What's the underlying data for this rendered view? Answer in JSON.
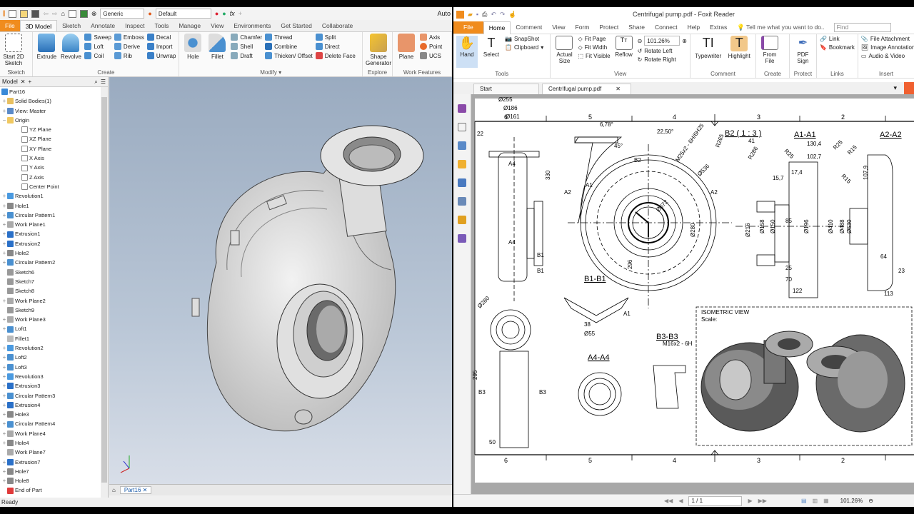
{
  "inventor": {
    "quick_access": {
      "appearance": "Generic",
      "material": "Default",
      "title_fragment": "Auto"
    },
    "tabs": [
      "File",
      "3D Model",
      "Sketch",
      "Annotate",
      "Inspect",
      "Tools",
      "Manage",
      "View",
      "Environments",
      "Get Started",
      "Collaborate"
    ],
    "active_tab": "3D Model",
    "ribbon": {
      "sketch": {
        "label": "Sketch",
        "start_sketch": "Start 2D Sketch"
      },
      "create": {
        "label": "Create",
        "extrude": "Extrude",
        "revolve": "Revolve",
        "sweep": "Sweep",
        "loft": "Loft",
        "coil": "Coil",
        "emboss": "Emboss",
        "derive": "Derive",
        "rib": "Rib",
        "decal": "Decal",
        "import": "Import",
        "unwrap": "Unwrap"
      },
      "modify": {
        "label": "Modify",
        "hole": "Hole",
        "fillet": "Fillet",
        "chamfer": "Chamfer",
        "shell": "Shell",
        "draft": "Draft",
        "thread": "Thread",
        "combine": "Combine",
        "thicken": "Thicken/ Offset",
        "split": "Split",
        "direct": "Direct",
        "delete_face": "Delete Face"
      },
      "explore": {
        "label": "Explore",
        "shape_generator": "Shape Generator"
      },
      "work_features": {
        "label": "Work Features",
        "plane": "Plane",
        "axis": "Axis",
        "point": "Point",
        "ucs": "UCS"
      }
    },
    "browser": {
      "tab": "Model",
      "items": [
        {
          "label": "Part16",
          "level": 0,
          "exp": ""
        },
        {
          "label": "Solid Bodies(1)",
          "level": 1,
          "exp": "+"
        },
        {
          "label": "View: Master",
          "level": 1,
          "exp": "+"
        },
        {
          "label": "Origin",
          "level": 1,
          "exp": "−"
        },
        {
          "label": "YZ Plane",
          "level": 2,
          "exp": ""
        },
        {
          "label": "XZ Plane",
          "level": 2,
          "exp": ""
        },
        {
          "label": "XY Plane",
          "level": 2,
          "exp": ""
        },
        {
          "label": "X Axis",
          "level": 2,
          "exp": ""
        },
        {
          "label": "Y Axis",
          "level": 2,
          "exp": ""
        },
        {
          "label": "Z Axis",
          "level": 2,
          "exp": ""
        },
        {
          "label": "Center Point",
          "level": 2,
          "exp": ""
        },
        {
          "label": "Revolution1",
          "level": 1,
          "exp": "+"
        },
        {
          "label": "Hole1",
          "level": 1,
          "exp": "+"
        },
        {
          "label": "Circular Pattern1",
          "level": 1,
          "exp": "+"
        },
        {
          "label": "Work Plane1",
          "level": 1,
          "exp": "+"
        },
        {
          "label": "Extrusion1",
          "level": 1,
          "exp": "+"
        },
        {
          "label": "Extrusion2",
          "level": 1,
          "exp": "+"
        },
        {
          "label": "Hole2",
          "level": 1,
          "exp": "+"
        },
        {
          "label": "Circular Pattern2",
          "level": 1,
          "exp": "+"
        },
        {
          "label": "Sketch6",
          "level": 1,
          "exp": ""
        },
        {
          "label": "Sketch7",
          "level": 1,
          "exp": ""
        },
        {
          "label": "Sketch8",
          "level": 1,
          "exp": ""
        },
        {
          "label": "Work Plane2",
          "level": 1,
          "exp": "+"
        },
        {
          "label": "Sketch9",
          "level": 1,
          "exp": ""
        },
        {
          "label": "Work Plane3",
          "level": 1,
          "exp": "+"
        },
        {
          "label": "Loft1",
          "level": 1,
          "exp": "+"
        },
        {
          "label": "Fillet1",
          "level": 1,
          "exp": ""
        },
        {
          "label": "Revolution2",
          "level": 1,
          "exp": "+"
        },
        {
          "label": "Loft2",
          "level": 1,
          "exp": "+"
        },
        {
          "label": "Loft3",
          "level": 1,
          "exp": "+"
        },
        {
          "label": "Revolution3",
          "level": 1,
          "exp": "+"
        },
        {
          "label": "Extrusion3",
          "level": 1,
          "exp": "+"
        },
        {
          "label": "Circular Pattern3",
          "level": 1,
          "exp": "+"
        },
        {
          "label": "Extrusion4",
          "level": 1,
          "exp": "+"
        },
        {
          "label": "Hole3",
          "level": 1,
          "exp": "+"
        },
        {
          "label": "Circular Pattern4",
          "level": 1,
          "exp": "+"
        },
        {
          "label": "Work Plane4",
          "level": 1,
          "exp": "+"
        },
        {
          "label": "Hole4",
          "level": 1,
          "exp": "+"
        },
        {
          "label": "Work Plane7",
          "level": 1,
          "exp": ""
        },
        {
          "label": "Extrusion7",
          "level": 1,
          "exp": "+"
        },
        {
          "label": "Hole7",
          "level": 1,
          "exp": "+"
        },
        {
          "label": "Hole8",
          "level": 1,
          "exp": "+"
        },
        {
          "label": "End of Part",
          "level": 1,
          "exp": ""
        }
      ]
    },
    "doc_tab": "Part16",
    "status": "Ready"
  },
  "foxit": {
    "title": "Centrifugal pump.pdf - Foxit Reader",
    "tabs": [
      "File",
      "Home",
      "Comment",
      "View",
      "Form",
      "Protect",
      "Share",
      "Connect",
      "Help",
      "Extras"
    ],
    "active_tab": "Home",
    "tell_me": "Tell me what you want to do..",
    "find_placeholder": "Find",
    "ribbon": {
      "tools": {
        "label": "Tools",
        "hand": "Hand",
        "select": "Select",
        "snapshot": "SnapShot",
        "clipboard": "Clipboard"
      },
      "view": {
        "label": "View",
        "actual_size": "Actual Size",
        "fit_page": "Fit Page",
        "fit_width": "Fit Width",
        "fit_visible": "Fit Visible",
        "reflow": "Reflow",
        "zoom": "101.26%",
        "rotate_left": "Rotate Left",
        "rotate_right": "Rotate Right"
      },
      "comment": {
        "label": "Comment",
        "typewriter": "Typewriter",
        "highlight": "Highlight"
      },
      "create": {
        "label": "Create",
        "from_file": "From File"
      },
      "protect": {
        "label": "Protect",
        "pdf_sign": "PDF Sign"
      },
      "links": {
        "label": "Links",
        "link": "Link",
        "bookmark": "Bookmark"
      },
      "insert": {
        "label": "Insert",
        "file_attachment": "File Attachment",
        "image_annotation": "Image Annotation",
        "audio_video": "Audio & Video"
      }
    },
    "doc_tabs": [
      "Start",
      "Centrifugal pump.pdf"
    ],
    "page_box": "1 / 1",
    "zoom_status": "101.26%",
    "drawing": {
      "ruler": [
        "6",
        "5",
        "4",
        "3",
        "2"
      ],
      "section_titles": {
        "b2": "B2 ( 1 : 3 )",
        "a1": "A1-A1",
        "a2": "A2-A2",
        "b1": "B1-B1",
        "a4": "A4-A4",
        "b3": "B3-B3"
      },
      "labels": [
        "Ø255",
        "Ø186",
        "Ø161",
        "22",
        "6,78°",
        "22,50°",
        "45°",
        "M25x2 - 6H/6H25",
        "Ø536",
        "Ø572",
        "330",
        "296",
        "A1",
        "A2",
        "A2",
        "A4",
        "A4",
        "B1",
        "B1",
        "B2",
        "130,4",
        "102,7",
        "R25",
        "R25",
        "R15",
        "R15",
        "R265",
        "R286",
        "41",
        "17,4",
        "15,7",
        "Ø280",
        "Ø216",
        "Ø158",
        "Ø150",
        "Ø196",
        "Ø410",
        "Ø488",
        "Ø530",
        "85",
        "107,9",
        "64",
        "23",
        "113",
        "122",
        "70",
        "25",
        "M16x2 - 6H",
        "38",
        "Ø55",
        "A1",
        "B3",
        "B3",
        "50",
        "295",
        "Ø280"
      ],
      "iso_title": "ISOMETRIC VIEW",
      "iso_scale": "Scale:"
    }
  }
}
